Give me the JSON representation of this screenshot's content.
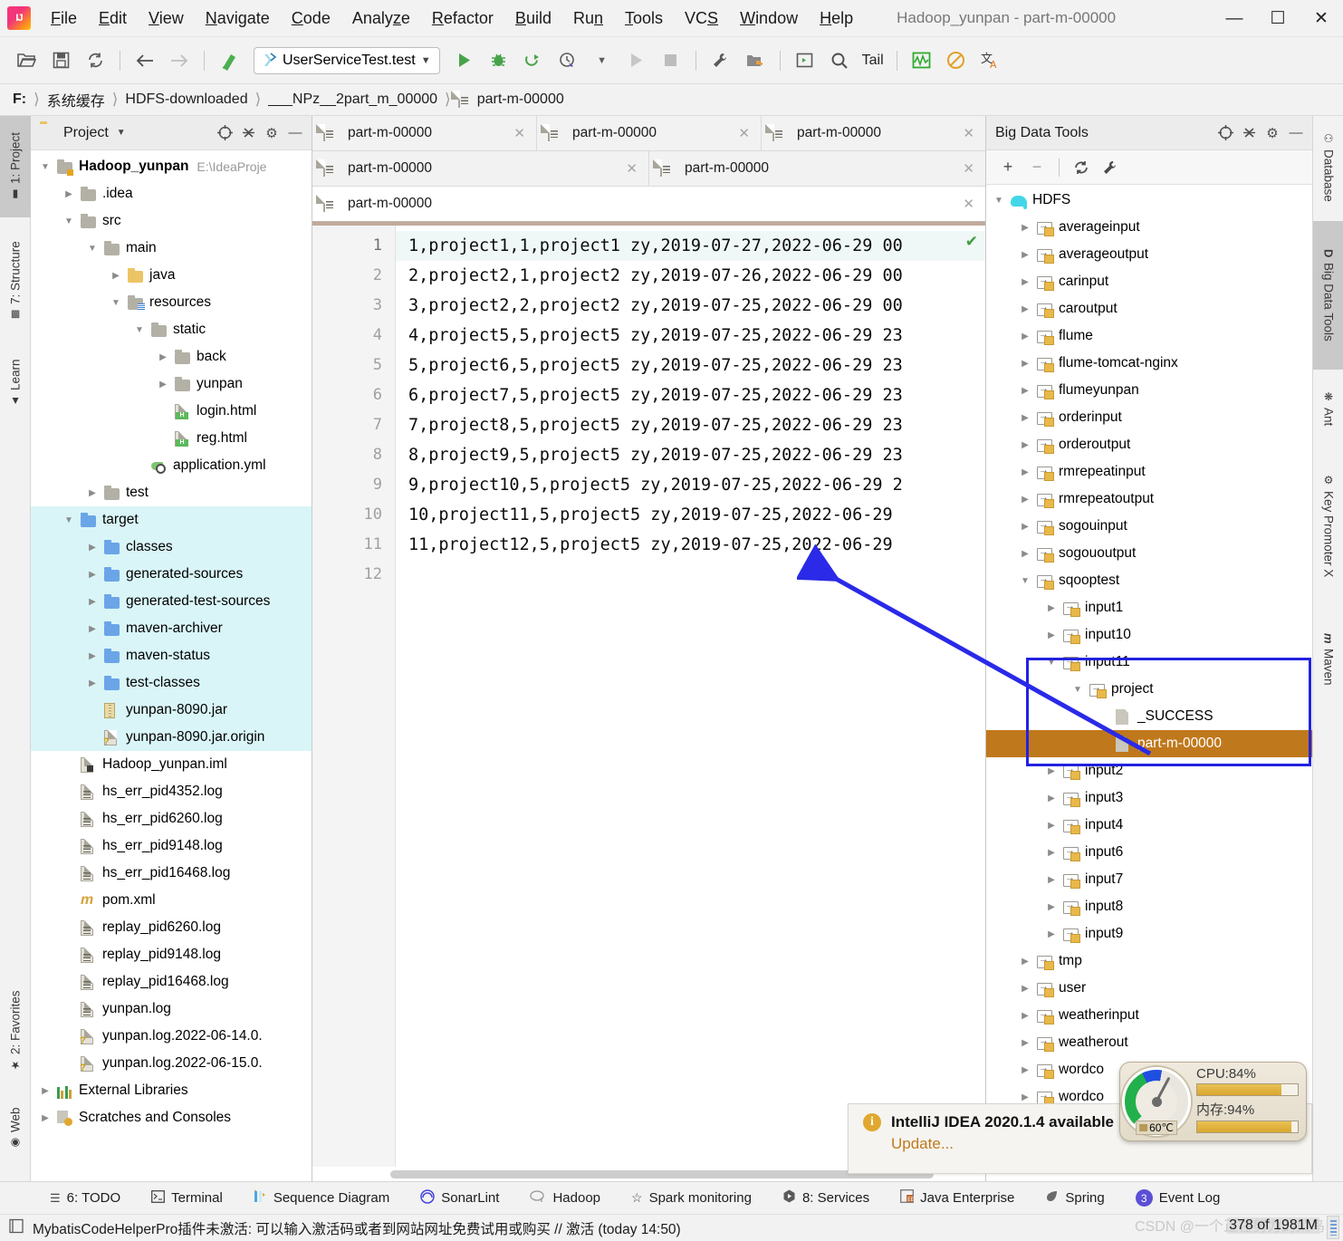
{
  "window": {
    "title": "Hadoop_yunpan - part-m-00000",
    "minimize": "—",
    "maximize": "☐",
    "close": "✕"
  },
  "menu": {
    "items": [
      {
        "label": "File",
        "mnemonic": "F"
      },
      {
        "label": "Edit",
        "mnemonic": "E"
      },
      {
        "label": "View",
        "mnemonic": "V"
      },
      {
        "label": "Navigate",
        "mnemonic": "N"
      },
      {
        "label": "Code",
        "mnemonic": "C"
      },
      {
        "label": "Analyze",
        "mnemonic": "z"
      },
      {
        "label": "Refactor",
        "mnemonic": "R"
      },
      {
        "label": "Build",
        "mnemonic": "B"
      },
      {
        "label": "Run",
        "mnemonic": "n"
      },
      {
        "label": "Tools",
        "mnemonic": "T"
      },
      {
        "label": "VCS",
        "mnemonic": "S"
      },
      {
        "label": "Window",
        "mnemonic": "W"
      },
      {
        "label": "Help",
        "mnemonic": "H"
      }
    ]
  },
  "toolbar": {
    "run_config": "UserServiceTest.test",
    "tail_label": "Tail",
    "icons": [
      "open-folder-icon",
      "save-all-icon",
      "sync-icon",
      "back-arrow-icon",
      "forward-arrow-icon",
      "build-icon",
      "run-icon",
      "debug-icon",
      "run-with-coverage-icon",
      "profile-icon",
      "run-disabled-icon",
      "stop-icon",
      "settings-wrench-icon",
      "project-structure-icon",
      "terminal-icon",
      "search-icon",
      "tail-icon",
      "monitoring-icon",
      "no-entry-icon",
      "translate-icon"
    ]
  },
  "breadcrumb": {
    "items": [
      "F:",
      "系统缓存",
      "HDFS-downloaded",
      "___NPz__2part_m_00000",
      "part-m-00000"
    ],
    "separator": "〉"
  },
  "left_tabs": [
    {
      "label": "1: Project",
      "icon": "project-icon",
      "active": true
    },
    {
      "label": "7: Structure",
      "icon": "structure-icon",
      "active": false
    },
    {
      "label": "Learn",
      "icon": "graduation-cap-icon",
      "active": false
    },
    {
      "label": "2: Favorites",
      "icon": "star-icon",
      "active": false
    },
    {
      "label": "Web",
      "icon": "globe-icon",
      "active": false
    }
  ],
  "right_tabs": [
    {
      "label": "Database",
      "icon": "database-icon",
      "active": false
    },
    {
      "label": "Big Data Tools",
      "icon": "bigdata-icon",
      "active": true
    },
    {
      "label": "Ant",
      "icon": "ant-icon",
      "active": false
    },
    {
      "label": "Key Promoter X",
      "icon": "key-promoter-icon",
      "active": false
    },
    {
      "label": "Maven",
      "icon": "maven-icon",
      "active": false
    }
  ],
  "project_panel": {
    "title": "Project",
    "header_icons": [
      "locate-icon",
      "collapse-all-icon",
      "gear-icon",
      "hide-icon"
    ],
    "tree": [
      {
        "label": "Hadoop_yunpan",
        "path": "E:\\IdeaProje",
        "depth": 0,
        "arrow": "open",
        "icon": "module-folder-icon",
        "bold": true
      },
      {
        "label": ".idea",
        "depth": 1,
        "arrow": "closed",
        "icon": "folder-icon"
      },
      {
        "label": "src",
        "depth": 1,
        "arrow": "open",
        "icon": "folder-icon"
      },
      {
        "label": "main",
        "depth": 2,
        "arrow": "open",
        "icon": "folder-icon"
      },
      {
        "label": "java",
        "depth": 3,
        "arrow": "closed",
        "icon": "source-folder-icon"
      },
      {
        "label": "resources",
        "depth": 3,
        "arrow": "open",
        "icon": "resources-folder-icon"
      },
      {
        "label": "static",
        "depth": 4,
        "arrow": "open",
        "icon": "folder-icon"
      },
      {
        "label": "back",
        "depth": 5,
        "arrow": "closed",
        "icon": "folder-icon"
      },
      {
        "label": "yunpan",
        "depth": 5,
        "arrow": "closed",
        "icon": "folder-icon"
      },
      {
        "label": "login.html",
        "depth": 5,
        "arrow": "none",
        "icon": "html-file-icon"
      },
      {
        "label": "reg.html",
        "depth": 5,
        "arrow": "none",
        "icon": "html-file-icon"
      },
      {
        "label": "application.yml",
        "depth": 4,
        "arrow": "none",
        "icon": "yaml-file-icon"
      },
      {
        "label": "test",
        "depth": 2,
        "arrow": "closed",
        "icon": "folder-icon"
      },
      {
        "label": "target",
        "depth": 1,
        "arrow": "open",
        "icon": "excluded-folder-icon",
        "highlight": true
      },
      {
        "label": "classes",
        "depth": 2,
        "arrow": "closed",
        "icon": "excluded-folder-icon",
        "highlight": true
      },
      {
        "label": "generated-sources",
        "depth": 2,
        "arrow": "closed",
        "icon": "excluded-folder-icon",
        "highlight": true
      },
      {
        "label": "generated-test-sources",
        "depth": 2,
        "arrow": "closed",
        "icon": "excluded-folder-icon",
        "highlight": true
      },
      {
        "label": "maven-archiver",
        "depth": 2,
        "arrow": "closed",
        "icon": "excluded-folder-icon",
        "highlight": true
      },
      {
        "label": "maven-status",
        "depth": 2,
        "arrow": "closed",
        "icon": "excluded-folder-icon",
        "highlight": true
      },
      {
        "label": "test-classes",
        "depth": 2,
        "arrow": "closed",
        "icon": "excluded-folder-icon",
        "highlight": true
      },
      {
        "label": "yunpan-8090.jar",
        "depth": 2,
        "arrow": "none",
        "icon": "jar-file-icon",
        "highlight": true
      },
      {
        "label": "yunpan-8090.jar.origin",
        "depth": 2,
        "arrow": "none",
        "icon": "unknown-file-icon",
        "highlight": true
      },
      {
        "label": "Hadoop_yunpan.iml",
        "depth": 1,
        "arrow": "none",
        "icon": "iml-file-icon"
      },
      {
        "label": "hs_err_pid4352.log",
        "depth": 1,
        "arrow": "none",
        "icon": "log-file-icon"
      },
      {
        "label": "hs_err_pid6260.log",
        "depth": 1,
        "arrow": "none",
        "icon": "log-file-icon"
      },
      {
        "label": "hs_err_pid9148.log",
        "depth": 1,
        "arrow": "none",
        "icon": "log-file-icon"
      },
      {
        "label": "hs_err_pid16468.log",
        "depth": 1,
        "arrow": "none",
        "icon": "log-file-icon"
      },
      {
        "label": "pom.xml",
        "depth": 1,
        "arrow": "none",
        "icon": "maven-pom-icon"
      },
      {
        "label": "replay_pid6260.log",
        "depth": 1,
        "arrow": "none",
        "icon": "log-file-icon"
      },
      {
        "label": "replay_pid9148.log",
        "depth": 1,
        "arrow": "none",
        "icon": "log-file-icon"
      },
      {
        "label": "replay_pid16468.log",
        "depth": 1,
        "arrow": "none",
        "icon": "log-file-icon"
      },
      {
        "label": "yunpan.log",
        "depth": 1,
        "arrow": "none",
        "icon": "log-file-icon"
      },
      {
        "label": "yunpan.log.2022-06-14.0.",
        "depth": 1,
        "arrow": "none",
        "icon": "unknown-file-icon"
      },
      {
        "label": "yunpan.log.2022-06-15.0.",
        "depth": 1,
        "arrow": "none",
        "icon": "unknown-file-icon"
      },
      {
        "label": "External Libraries",
        "depth": 0,
        "arrow": "closed",
        "icon": "libraries-icon"
      },
      {
        "label": "Scratches and Consoles",
        "depth": 0,
        "arrow": "closed",
        "icon": "scratches-icon"
      }
    ]
  },
  "editor": {
    "tab_rows": [
      [
        {
          "label": "part-m-00000",
          "active": false,
          "close": "✕"
        },
        {
          "label": "part-m-00000",
          "active": false,
          "close": "✕"
        },
        {
          "label": "part-m-00000",
          "active": false,
          "close": "✕"
        }
      ],
      [
        {
          "label": "part-m-00000",
          "active": false,
          "close": "✕"
        },
        {
          "label": "part-m-00000",
          "active": false,
          "close": "✕"
        }
      ],
      [
        {
          "label": "part-m-00000",
          "active": true,
          "close": "✕"
        }
      ]
    ],
    "line_numbers": [
      "1",
      "2",
      "3",
      "4",
      "5",
      "6",
      "7",
      "8",
      "9",
      "10",
      "11",
      "12"
    ],
    "lines": [
      "1,project1,1,project1 zy,2019-07-27,2022-06-29 00",
      "2,project2,1,project2 zy,2019-07-26,2022-06-29 00",
      "3,project2,2,project2 zy,2019-07-25,2022-06-29 00",
      "4,project5,5,project5 zy,2019-07-25,2022-06-29 23",
      "5,project6,5,project5 zy,2019-07-25,2022-06-29 23",
      "6,project7,5,project5 zy,2019-07-25,2022-06-29 23",
      "7,project8,5,project5 zy,2019-07-25,2022-06-29 23",
      "8,project9,5,project5 zy,2019-07-25,2022-06-29 23",
      "9,project10,5,project5 zy,2019-07-25,2022-06-29 2",
      "10,project11,5,project5 zy,2019-07-25,2022-06-29",
      "11,project12,5,project5 zy,2019-07-25,2022-06-29",
      ""
    ],
    "inspection_mark": "✔"
  },
  "bigdata_panel": {
    "title": "Big Data Tools",
    "header_icons": [
      "locate-icon",
      "collapse-all-icon",
      "gear-icon",
      "hide-icon"
    ],
    "toolbar_icons": [
      "add-icon",
      "remove-icon",
      "refresh-icon",
      "wrench-icon"
    ],
    "toolbar_labels": {
      "add": "+",
      "remove": "−",
      "refresh": "↻",
      "wrench": "🔧"
    },
    "tree": [
      {
        "label": "HDFS",
        "depth": 0,
        "arrow": "open",
        "icon": "hadoop-elephant-icon"
      },
      {
        "label": "averageinput",
        "depth": 1,
        "arrow": "closed",
        "icon": "hdfs-folder-icon"
      },
      {
        "label": "averageoutput",
        "depth": 1,
        "arrow": "closed",
        "icon": "hdfs-folder-icon"
      },
      {
        "label": "carinput",
        "depth": 1,
        "arrow": "closed",
        "icon": "hdfs-folder-icon"
      },
      {
        "label": "caroutput",
        "depth": 1,
        "arrow": "closed",
        "icon": "hdfs-folder-icon"
      },
      {
        "label": "flume",
        "depth": 1,
        "arrow": "closed",
        "icon": "hdfs-folder-icon"
      },
      {
        "label": "flume-tomcat-nginx",
        "depth": 1,
        "arrow": "closed",
        "icon": "hdfs-folder-icon"
      },
      {
        "label": "flumeyunpan",
        "depth": 1,
        "arrow": "closed",
        "icon": "hdfs-folder-icon"
      },
      {
        "label": "orderinput",
        "depth": 1,
        "arrow": "closed",
        "icon": "hdfs-folder-icon"
      },
      {
        "label": "orderoutput",
        "depth": 1,
        "arrow": "closed",
        "icon": "hdfs-folder-icon"
      },
      {
        "label": "rmrepeatinput",
        "depth": 1,
        "arrow": "closed",
        "icon": "hdfs-folder-icon"
      },
      {
        "label": "rmrepeatoutput",
        "depth": 1,
        "arrow": "closed",
        "icon": "hdfs-folder-icon"
      },
      {
        "label": "sogouinput",
        "depth": 1,
        "arrow": "closed",
        "icon": "hdfs-folder-icon"
      },
      {
        "label": "sogououtput",
        "depth": 1,
        "arrow": "closed",
        "icon": "hdfs-folder-icon"
      },
      {
        "label": "sqooptest",
        "depth": 1,
        "arrow": "open",
        "icon": "hdfs-folder-icon"
      },
      {
        "label": "input1",
        "depth": 2,
        "arrow": "closed",
        "icon": "hdfs-folder-icon"
      },
      {
        "label": "input10",
        "depth": 2,
        "arrow": "closed",
        "icon": "hdfs-folder-icon"
      },
      {
        "label": "input11",
        "depth": 2,
        "arrow": "open",
        "icon": "hdfs-folder-icon"
      },
      {
        "label": "project",
        "depth": 3,
        "arrow": "open",
        "icon": "hdfs-folder-icon"
      },
      {
        "label": "_SUCCESS",
        "depth": 4,
        "arrow": "none",
        "icon": "hdfs-file-icon"
      },
      {
        "label": "part-m-00000",
        "depth": 4,
        "arrow": "none",
        "icon": "hdfs-file-icon",
        "selected": true
      },
      {
        "label": "input2",
        "depth": 2,
        "arrow": "closed",
        "icon": "hdfs-folder-icon"
      },
      {
        "label": "input3",
        "depth": 2,
        "arrow": "closed",
        "icon": "hdfs-folder-icon"
      },
      {
        "label": "input4",
        "depth": 2,
        "arrow": "closed",
        "icon": "hdfs-folder-icon"
      },
      {
        "label": "input6",
        "depth": 2,
        "arrow": "closed",
        "icon": "hdfs-folder-icon"
      },
      {
        "label": "input7",
        "depth": 2,
        "arrow": "closed",
        "icon": "hdfs-folder-icon"
      },
      {
        "label": "input8",
        "depth": 2,
        "arrow": "closed",
        "icon": "hdfs-folder-icon"
      },
      {
        "label": "input9",
        "depth": 2,
        "arrow": "closed",
        "icon": "hdfs-folder-icon"
      },
      {
        "label": "tmp",
        "depth": 1,
        "arrow": "closed",
        "icon": "hdfs-folder-icon"
      },
      {
        "label": "user",
        "depth": 1,
        "arrow": "closed",
        "icon": "hdfs-folder-icon"
      },
      {
        "label": "weatherinput",
        "depth": 1,
        "arrow": "closed",
        "icon": "hdfs-folder-icon"
      },
      {
        "label": "weatherout",
        "depth": 1,
        "arrow": "closed",
        "icon": "hdfs-folder-icon"
      },
      {
        "label": "wordco",
        "depth": 1,
        "arrow": "closed",
        "icon": "hdfs-folder-icon"
      },
      {
        "label": "wordco",
        "depth": 1,
        "arrow": "closed",
        "icon": "hdfs-folder-icon"
      }
    ]
  },
  "cpu_widget": {
    "cpu_label": "CPU:84%",
    "cpu_percent": 84,
    "memory_label": "内存:94%",
    "memory_percent": 94,
    "temperature": "60℃"
  },
  "notification": {
    "icon": "info-icon",
    "title": "IntelliJ IDEA 2020.1.4 available",
    "link": "Update..."
  },
  "tool_windows": [
    {
      "label": "6: TODO",
      "icon": "todo-icon"
    },
    {
      "label": "Terminal",
      "icon": "terminal-icon"
    },
    {
      "label": "Sequence Diagram",
      "icon": "sequence-diagram-icon"
    },
    {
      "label": "SonarLint",
      "icon": "sonarlint-icon"
    },
    {
      "label": "Hadoop",
      "icon": "hadoop-icon"
    },
    {
      "label": "Spark monitoring",
      "icon": "star-icon"
    },
    {
      "label": "8: Services",
      "icon": "services-icon"
    },
    {
      "label": "Java Enterprise",
      "icon": "java-enterprise-icon"
    },
    {
      "label": "Spring",
      "icon": "spring-leaf-icon"
    },
    {
      "label": "Event Log",
      "icon": "event-log-icon",
      "badge": "3"
    }
  ],
  "status_bar": {
    "icon": "notification-icon",
    "message": "MybatisCodeHelperPro插件未激活: 可以输入激活码或者到网站网址免费试用或购买 // 激活 (today 14:50)",
    "memory": "378 of 1981M",
    "watermark": "CSDN @一个正在努力的菜鸟"
  },
  "colors": {
    "selection_orange": "#c0781c",
    "annotation_blue": "#2222e0",
    "module_highlight": "#d9f5f8",
    "accent_link": "#c07a1c"
  }
}
